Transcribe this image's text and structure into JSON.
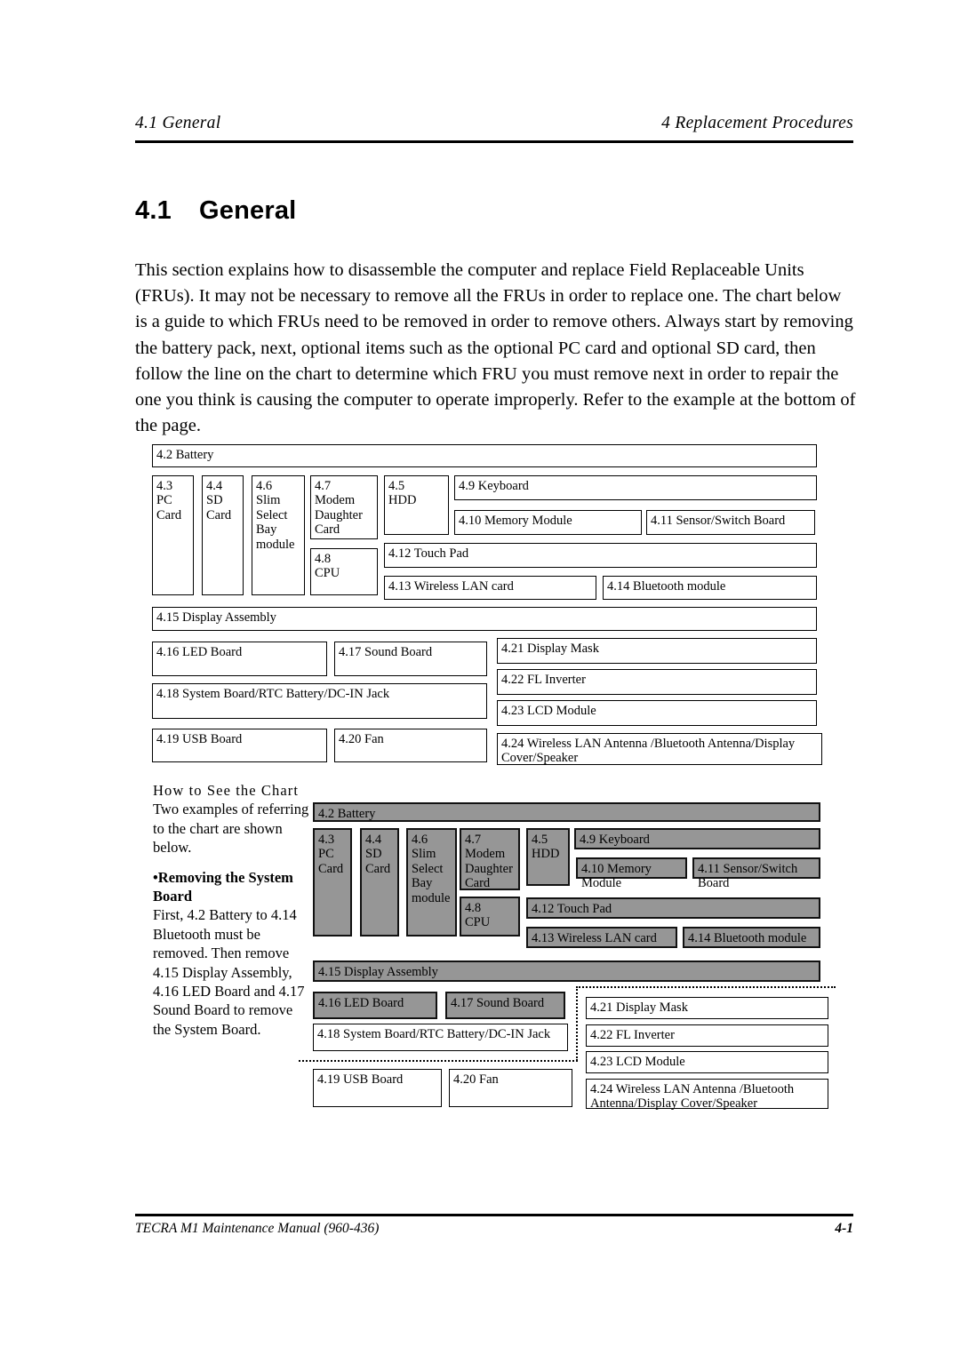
{
  "runhead": {
    "left": "4.1  General",
    "right": "4 Replacement Procedures"
  },
  "footer": {
    "left": "TECRA M1 Maintenance Manual (960-436)",
    "right": "4-1"
  },
  "heading": {
    "number": "4.1",
    "title": "General"
  },
  "paragraph": "This section explains how to disassemble the computer and replace Field Replaceable Units (FRUs). It may not be necessary to remove all the FRUs in order to replace one. The chart below is a guide to which FRUs need to be removed in order to remove others.  Always start by removing the battery pack, next, optional items such as the optional PC card and optional SD card, then follow the line on the chart to determine which FRU you must remove next in order to repair the one you think is causing the computer to operate improperly. Refer to the example at the bottom of the page.",
  "howto": {
    "title": "How to See the Chart",
    "intro": "Two examples of referring to the chart are shown below.",
    "bullet": "•Removing the System Board",
    "body": "First, 4.2 Battery to 4.14 Bluetooth must be removed.  Then remove 4.15 Display Assembly, 4.16 LED Board and 4.17 Sound Board to remove the System Board."
  },
  "colors": {
    "shaded_box": "#969696",
    "box_border": "#000000",
    "page_background": "#ffffff"
  },
  "chart_data": {
    "type": "diagram",
    "title": "FRU removal order chart",
    "charts": [
      {
        "name": "reference-chart",
        "shaded": false,
        "boxes": [
          {
            "id": "4.2",
            "label": "4.2  Battery"
          },
          {
            "id": "4.3",
            "label": "4.3\nPC\nCard"
          },
          {
            "id": "4.4",
            "label": "4.4\nSD\nCard"
          },
          {
            "id": "4.6",
            "label": "4.6\nSlim\nSelect\nBay\nmodule"
          },
          {
            "id": "4.7",
            "label": "4.7\nModem\nDaughter\nCard"
          },
          {
            "id": "4.8",
            "label": "4.8\nCPU"
          },
          {
            "id": "4.5",
            "label": "4.5\nHDD"
          },
          {
            "id": "4.9",
            "label": "4.9  Keyboard"
          },
          {
            "id": "4.10",
            "label": "4.10  Memory Module"
          },
          {
            "id": "4.11",
            "label": "4.11  Sensor/Switch Board"
          },
          {
            "id": "4.12",
            "label": "4.12  Touch Pad"
          },
          {
            "id": "4.13",
            "label": "4.13   Wireless LAN card"
          },
          {
            "id": "4.14",
            "label": "4.14  Bluetooth module"
          },
          {
            "id": "4.15",
            "label": "4.15  Display Assembly"
          },
          {
            "id": "4.16",
            "label": "4.16  LED Board"
          },
          {
            "id": "4.17",
            "label": "4.17  Sound Board"
          },
          {
            "id": "4.18",
            "label": "4.18  System Board/RTC Battery/DC-IN Jack"
          },
          {
            "id": "4.19",
            "label": "4.19  USB Board"
          },
          {
            "id": "4.20",
            "label": "4.20  Fan"
          },
          {
            "id": "4.21",
            "label": "4.21  Display Mask"
          },
          {
            "id": "4.22",
            "label": "4.22  FL Inverter"
          },
          {
            "id": "4.23",
            "label": "4.23  LCD Module"
          },
          {
            "id": "4.24",
            "label": "4.24  Wireless LAN Antenna /Bluetooth Antenna/Display Cover/Speaker"
          }
        ]
      },
      {
        "name": "example-chart-system-board",
        "shaded": true,
        "highlight": "dotted outline around 4.15/4.16/4.17/4.18 group",
        "boxes": [
          {
            "id": "4.2",
            "label": "4.2  Battery",
            "shaded": true
          },
          {
            "id": "4.3",
            "label": "4.3\nPC\nCard",
            "shaded": true
          },
          {
            "id": "4.4",
            "label": "4.4\nSD\nCard",
            "shaded": true
          },
          {
            "id": "4.6",
            "label": "4.6\nSlim\nSelect\nBay\nmodule",
            "shaded": true
          },
          {
            "id": "4.7",
            "label": "4.7\nModem\nDaughter\nCard",
            "shaded": true
          },
          {
            "id": "4.8",
            "label": "4.8\nCPU",
            "shaded": true
          },
          {
            "id": "4.5",
            "label": "4.5\nHDD",
            "shaded": true
          },
          {
            "id": "4.9",
            "label": "4.9  Keyboard",
            "shaded": true
          },
          {
            "id": "4.10",
            "label": "4.10  Memory Module",
            "shaded": true
          },
          {
            "id": "4.11",
            "label": "4.11  Sensor/Switch Board",
            "shaded": true
          },
          {
            "id": "4.12",
            "label": "4.12  Touch Pad",
            "shaded": true
          },
          {
            "id": "4.13",
            "label": "4.13   Wireless LAN card",
            "shaded": true
          },
          {
            "id": "4.14",
            "label": "4.14  Bluetooth module",
            "shaded": true
          },
          {
            "id": "4.15",
            "label": "4.15  Display Assembly",
            "shaded": true
          },
          {
            "id": "4.16",
            "label": "4.16  LED Board",
            "shaded": true
          },
          {
            "id": "4.17",
            "label": "4.17  Sound Board",
            "shaded": true
          },
          {
            "id": "4.18",
            "label": "4.18  System Board/RTC Battery/DC-IN Jack",
            "shaded": false
          },
          {
            "id": "4.19",
            "label": "4.19  USB Board",
            "shaded": false
          },
          {
            "id": "4.20",
            "label": "4.20  Fan",
            "shaded": false
          },
          {
            "id": "4.21",
            "label": "4.21  Display Mask",
            "shaded": false
          },
          {
            "id": "4.22",
            "label": "4.22  FL Inverter",
            "shaded": false
          },
          {
            "id": "4.23",
            "label": "4.23  LCD Module",
            "shaded": false
          },
          {
            "id": "4.24",
            "label": "4.24  Wireless LAN Antenna /Bluetooth Antenna/Display Cover/Speaker",
            "shaded": false
          }
        ]
      }
    ]
  }
}
